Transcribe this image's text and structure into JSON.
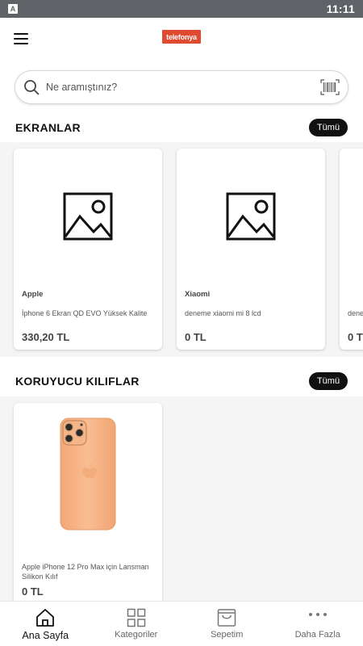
{
  "status_bar": {
    "indicator": "A",
    "time": "11:11"
  },
  "header": {
    "logo_text": "telefonya",
    "menu_icon": "hamburger-menu-icon"
  },
  "search": {
    "placeholder": "Ne aramıştınız?",
    "value": "",
    "left_icon": "search-icon",
    "right_icon": "barcode-scan-icon"
  },
  "sections": [
    {
      "title": "EKRANLAR",
      "all_label": "Tümü",
      "products": [
        {
          "brand": "Apple",
          "name": "İphone 6 Ekran QD EVO Yüksek Kalite",
          "price": "330,20 TL",
          "image": "image-placeholder-icon"
        },
        {
          "brand": "Xiaomi",
          "name": "deneme xiaomi mi 8 lcd",
          "price": "0 TL",
          "image": "image-placeholder-icon"
        },
        {
          "brand": "",
          "name": "dene",
          "price": "0 T",
          "image": ""
        }
      ]
    },
    {
      "title": "KORUYUCU KILIFLAR",
      "all_label": "Tümü",
      "products": [
        {
          "brand": "",
          "name": "Apple iPhone 12 Pro Max için Lansman Silikon Kılıf",
          "price": "0 TL",
          "image": "phone-case-image"
        }
      ]
    }
  ],
  "bottom_nav": [
    {
      "label": "Ana Sayfa",
      "icon": "home-icon",
      "active": true
    },
    {
      "label": "Kategoriler",
      "icon": "grid-icon",
      "active": false
    },
    {
      "label": "Sepetim",
      "icon": "shopping-bag-icon",
      "active": false
    },
    {
      "label": "Daha Fazla",
      "icon": "more-dots-icon",
      "active": false
    }
  ],
  "colors": {
    "accent": "#111111",
    "logo_bg": "#e04a30",
    "case_peach": "#f8b98a",
    "status_bar": "#5f6368"
  }
}
